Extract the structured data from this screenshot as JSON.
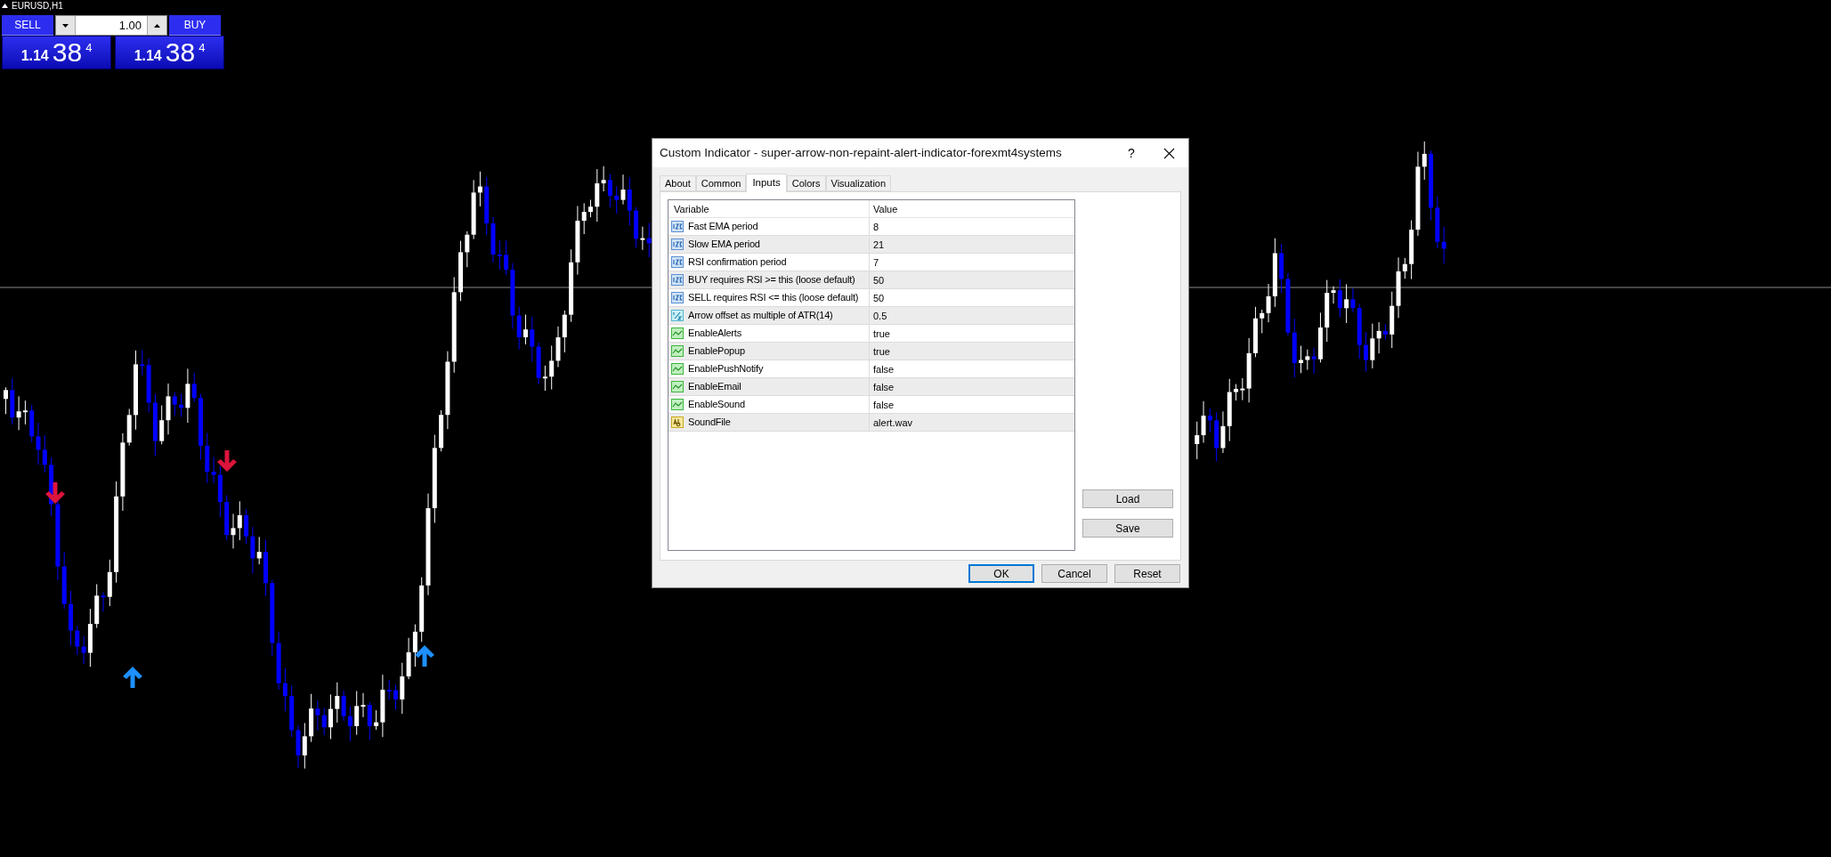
{
  "chart": {
    "symbol": "EURUSD,H1"
  },
  "trade_panel": {
    "sell_label": "SELL",
    "buy_label": "BUY",
    "volume": "1.00",
    "sell_price": {
      "prefix": "1.14",
      "big": "38",
      "sup": "4"
    },
    "buy_price": {
      "prefix": "1.14",
      "big": "38",
      "sup": "4"
    }
  },
  "dialog": {
    "title": "Custom Indicator - super-arrow-non-repaint-alert-indicator-forexmt4systems",
    "help": "?",
    "tabs": [
      {
        "label": "About",
        "selected": false
      },
      {
        "label": "Common",
        "selected": false
      },
      {
        "label": "Inputs",
        "selected": true
      },
      {
        "label": "Colors",
        "selected": false
      },
      {
        "label": "Visualization",
        "selected": false
      }
    ],
    "table": {
      "columns": [
        "Variable",
        "Value"
      ],
      "rows": [
        {
          "kind": "int",
          "variable": "Fast EMA period",
          "value": "8"
        },
        {
          "kind": "int",
          "variable": "Slow EMA period",
          "value": "21"
        },
        {
          "kind": "int",
          "variable": "RSI confirmation period",
          "value": "7"
        },
        {
          "kind": "int",
          "variable": "BUY requires RSI >= this (loose default)",
          "value": "50"
        },
        {
          "kind": "int",
          "variable": "SELL requires RSI <= this (loose default)",
          "value": "50"
        },
        {
          "kind": "double",
          "variable": "Arrow offset as multiple of ATR(14)",
          "value": "0.5"
        },
        {
          "kind": "bool",
          "variable": "EnableAlerts",
          "value": "true"
        },
        {
          "kind": "bool",
          "variable": "EnablePopup",
          "value": "true"
        },
        {
          "kind": "bool",
          "variable": "EnablePushNotify",
          "value": "false"
        },
        {
          "kind": "bool",
          "variable": "EnableEmail",
          "value": "false"
        },
        {
          "kind": "bool",
          "variable": "EnableSound",
          "value": "false"
        },
        {
          "kind": "string",
          "variable": "SoundFile",
          "value": "alert.wav"
        }
      ]
    },
    "side_buttons": [
      "Load",
      "Save"
    ],
    "buttons": [
      {
        "label": "OK",
        "default": true
      },
      {
        "label": "Cancel",
        "default": false
      },
      {
        "label": "Reset",
        "default": false
      }
    ]
  }
}
